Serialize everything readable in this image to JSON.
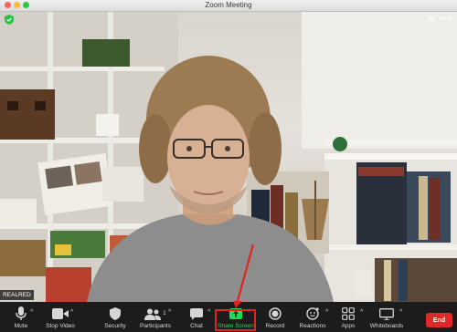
{
  "window": {
    "title": "Zoom Meeting"
  },
  "video": {
    "participant_name": "REALRED"
  },
  "top_bar": {
    "view_label": "View"
  },
  "toolbar": {
    "mute_label": "Mute",
    "stop_video_label": "Stop Video",
    "security_label": "Security",
    "participants_label": "Participants",
    "participants_count": "1",
    "chat_label": "Chat",
    "share_screen_label": "Share Screen",
    "record_label": "Record",
    "reactions_label": "Reactions",
    "apps_label": "Apps",
    "whiteboards_label": "Whiteboards",
    "end_label": "End"
  },
  "colors": {
    "toolbar_bg": "#1c1c1c",
    "share_green": "#23d959",
    "end_red": "#e02828",
    "annotation_red": "#e0231c"
  },
  "icons": [
    "shield-check-icon",
    "view-grid-icon",
    "microphone-icon",
    "video-camera-icon",
    "shield-icon",
    "participants-icon",
    "chat-bubble-icon",
    "share-screen-icon",
    "record-icon",
    "reactions-icon",
    "apps-icon",
    "whiteboard-icon"
  ]
}
